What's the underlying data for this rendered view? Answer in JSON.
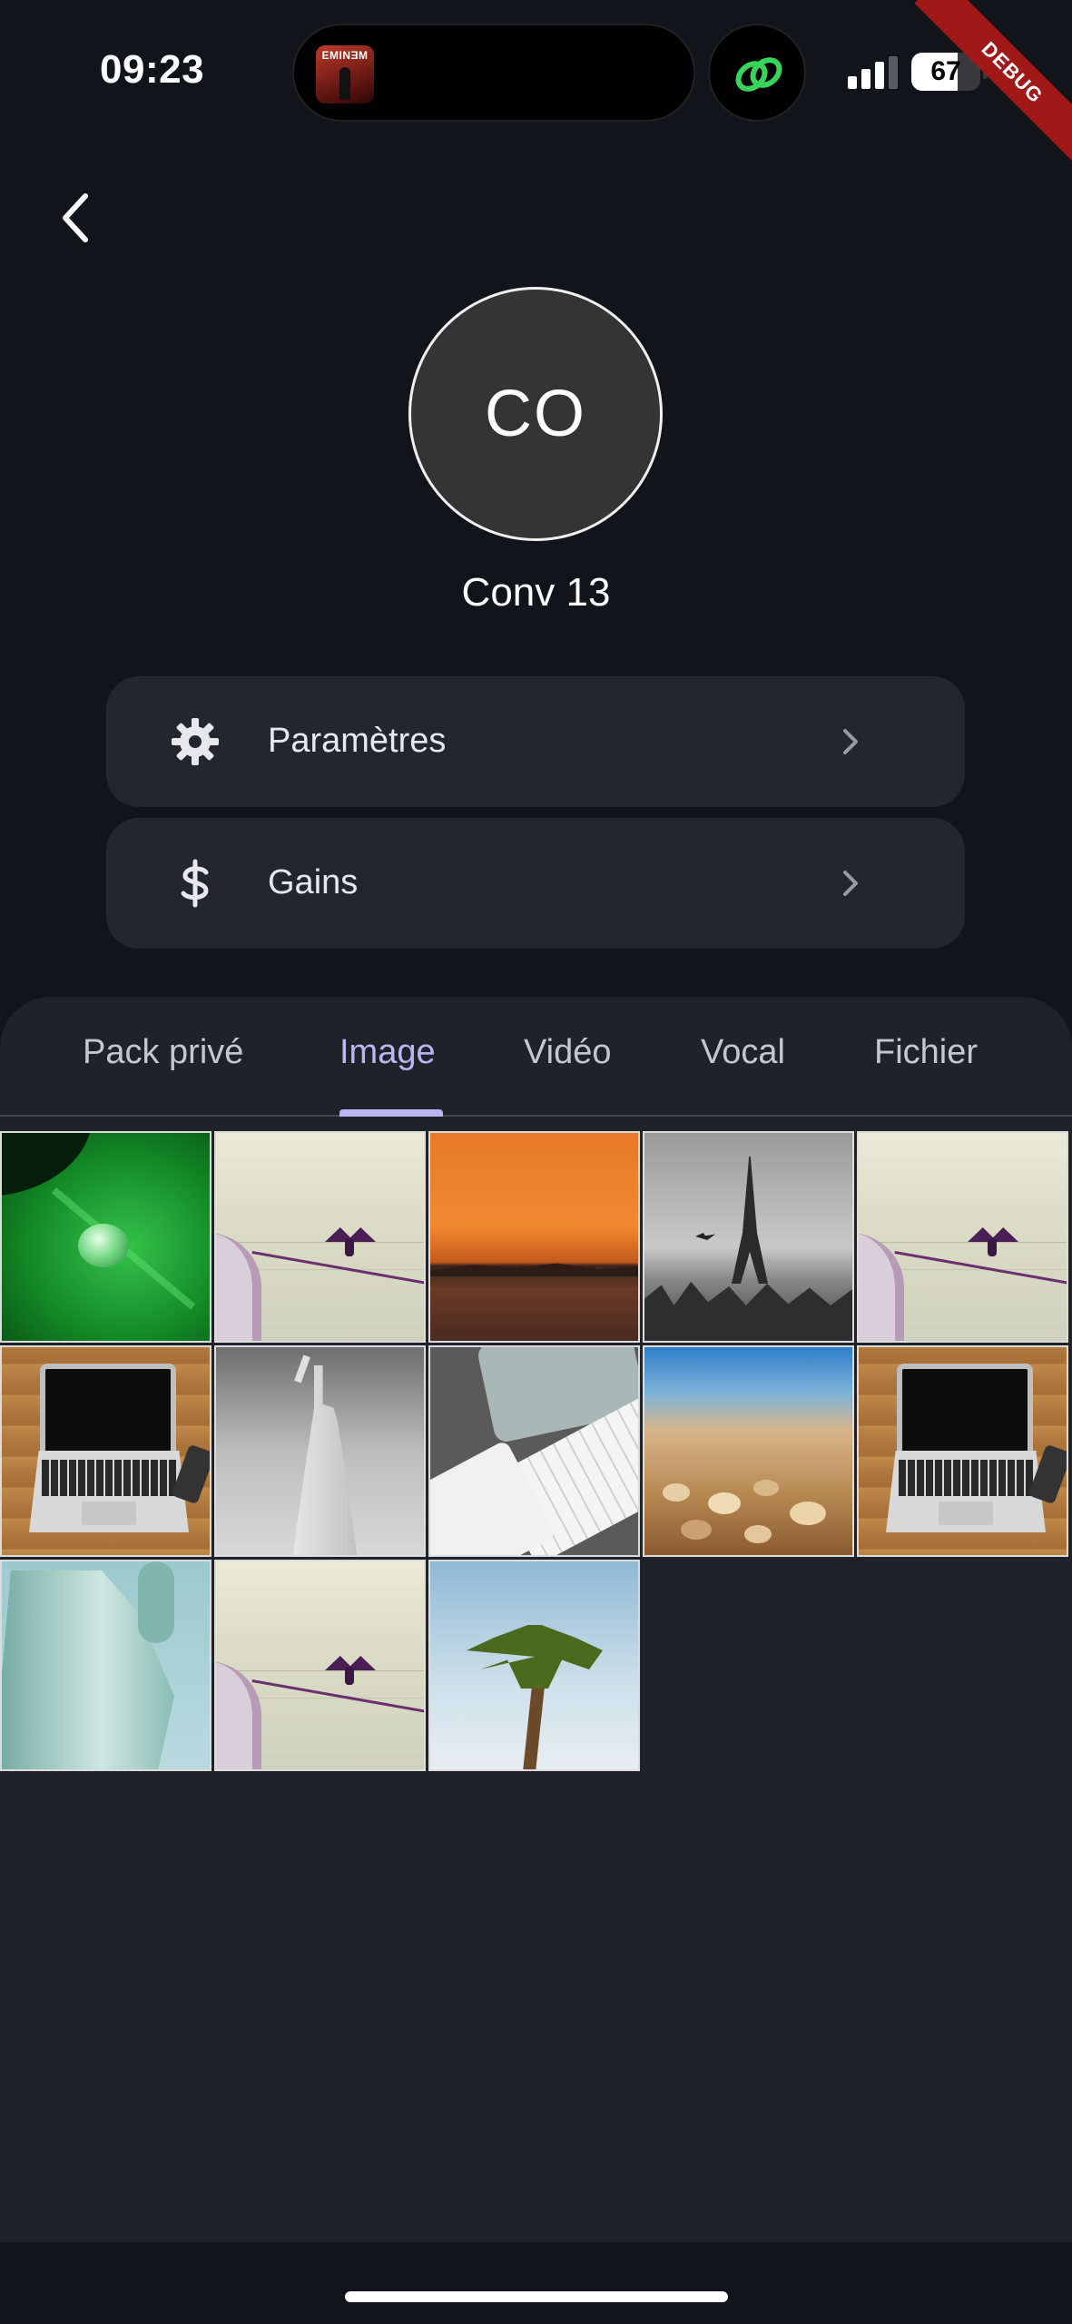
{
  "status_bar": {
    "time": "09:23",
    "battery_percent": 67,
    "battery_label": "67",
    "signal_bars": 3,
    "now_playing_art_text": "EMINƎM",
    "debug_label": "DEBUG"
  },
  "header": {
    "avatar_initials": "CO",
    "conversation_name": "Conv 13"
  },
  "menu": [
    {
      "label": "Paramètres",
      "icon": "gear-icon"
    },
    {
      "label": "Gains",
      "icon": "dollar-icon"
    }
  ],
  "tabs": {
    "items": [
      "Pack privé",
      "Image",
      "Vidéo",
      "Vocal",
      "Fichier"
    ],
    "active": "Image"
  },
  "gallery": {
    "images": [
      "leaf-water-drop",
      "cormorant-on-boat",
      "orange-sunset-sea",
      "eiffel-tower-bw",
      "cormorant-on-boat",
      "laptop-on-wooden-desk",
      "statue-of-liberty-bw",
      "keyboard-and-tablet",
      "beach-shells",
      "laptop-on-wooden-desk",
      "statue-of-liberty-green",
      "cormorant-on-boat",
      "palm-tree-sky"
    ]
  },
  "colors": {
    "background": "#13131a",
    "sheet": "#21212a",
    "card": "#25252d",
    "accent": "#b9b6f2",
    "debug_ribbon": "#a01818"
  }
}
